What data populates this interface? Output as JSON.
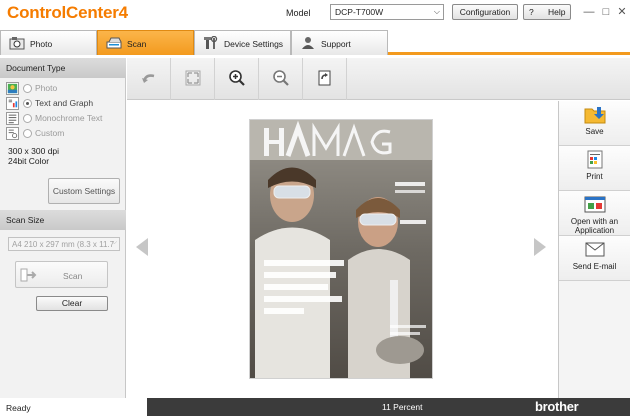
{
  "app": {
    "title": "ControlCenter4",
    "model_label": "Model",
    "model_value": "DCP-T700W",
    "configuration_label": "Configuration",
    "help_label": "Help",
    "help_glyph": "?"
  },
  "tabs": [
    {
      "label": "Photo",
      "icon": "photo-icon"
    },
    {
      "label": "Scan",
      "icon": "scan-icon",
      "active": true
    },
    {
      "label": "Device Settings",
      "icon": "tools-icon"
    },
    {
      "label": "Support",
      "icon": "support-icon"
    }
  ],
  "left_panel": {
    "document_type_header": "Document Type",
    "document_types": [
      {
        "label": "Photo",
        "selected": false
      },
      {
        "label": "Text and Graph",
        "selected": true
      },
      {
        "label": "Monochrome Text",
        "selected": false
      },
      {
        "label": "Custom",
        "selected": false
      }
    ],
    "resolution": "300 x 300 dpi",
    "color_mode": "24bit Color",
    "custom_settings_label": "Custom Settings",
    "scan_size_header": "Scan Size",
    "scan_size_value": "A4 210 x 297 mm (8.3 x 11.7",
    "scan_button_label": "Scan",
    "clear_button_label": "Clear"
  },
  "toolbar": {
    "tools": [
      "rotate-icon",
      "fit-to-window-icon",
      "zoom-in-icon",
      "zoom-out-icon",
      "rotate-page-icon"
    ]
  },
  "actions": [
    {
      "label": "Save",
      "icon": "save-folder-icon"
    },
    {
      "label": "Print",
      "icon": "print-icon"
    },
    {
      "label": "Open with an Application",
      "icon": "open-with-app-icon"
    },
    {
      "label": "Send E-mail",
      "icon": "email-icon"
    }
  ],
  "status": {
    "left": "Ready",
    "zoom": "11 Percent",
    "brand": "brother"
  },
  "colors": {
    "accent": "#f39a1e",
    "brand_title": "#f57c00",
    "status_bar": "#3b3b3b"
  }
}
